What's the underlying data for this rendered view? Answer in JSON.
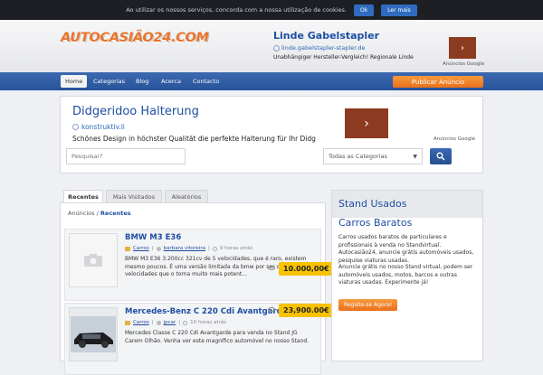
{
  "cookie": {
    "message": "Ao utilizar os nossos serviços, concorda com a nossa utilização de cookies.",
    "ok_label": "Ok",
    "more_label": "Ler mais"
  },
  "header": {
    "logo_text": "AUTOCASIÃO24.COM",
    "ad_title": "Linde Gabelstapler",
    "ad_url": "linde.gabelstapler-stapler.de",
    "ad_desc": "Unabhängiger Hersteller-Vergleich! Regionale Linde",
    "ads_label": "Anúncios Google"
  },
  "nav": {
    "items": [
      "Home",
      "Categorias",
      "Blog",
      "Acerca",
      "Contacto"
    ],
    "publish_label": "Publicar Anúncio"
  },
  "bigad": {
    "title": "Didgeridoo Halterung",
    "url": "konstruktiv.li",
    "desc": "Schönes Design in höchster Qualität die perfekte Halterung für Ihr Didg",
    "ads_label": "Anúncios Google"
  },
  "search": {
    "placeholder": "Pesquisar?",
    "category_value": "Todas as Categorias"
  },
  "tabs": [
    "Recentes",
    "Mais Visitados",
    "Aleatórios"
  ],
  "breadcrumb": {
    "root": "Anúncios",
    "sep": "/",
    "current": "Recentes"
  },
  "listings": [
    {
      "title": "BMW M3 E36",
      "category": "Carros",
      "location": "barbara vitoreira",
      "time": "9 horas atrás",
      "desc": "BMW M3 E36 3.200cc 321cv de 5 velocidades, que é raro, existem mesmo poucos. É uma versão limitada da bmw por ser de 5 velocidades que o torna muito mais potent...",
      "price": "10.000,00€"
    },
    {
      "title": "Mercedes-Benz C 220 Cdi Avantgarde",
      "category": "Carros",
      "location": "jpcar",
      "time": "10 horas atrás",
      "desc": "Mercedes Classe C 220 Cdi Avantgarde para venda no Stand JG Carem Olhão. Venha ver este magnífico automóvel no nosso Stand.",
      "price": "23,900.00€"
    }
  ],
  "sidebar": {
    "head": "Stand Usados",
    "title": "Carros Baratos",
    "p1": "Carros usados baratos de particulares e profissionais à venda no Standvirtual. Autocasião24, anuncie grátis automóveis usados, pesquise viaturas usadas.",
    "p2": "Anuncie grátis no nosso Stand virtual, podem ser automóveis usados, motos, barcos e outras viaturas usadas. Experimente já!",
    "register_label": "Registe-se Agora!"
  },
  "colors": {
    "accent_orange": "#e9701c",
    "brand_blue": "#2a56a0",
    "price_yellow": "#f8c200"
  }
}
